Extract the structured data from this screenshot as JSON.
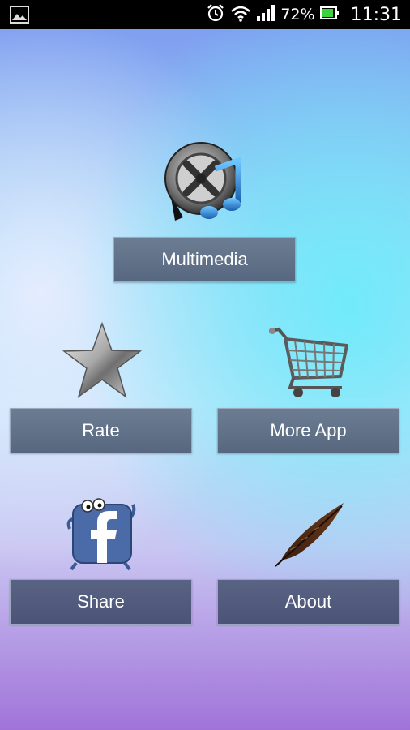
{
  "status_bar": {
    "battery": "72%",
    "time": "11:31",
    "icons": [
      "gallery-icon",
      "alarm-icon",
      "wifi-icon",
      "signal-icon",
      "battery-icon"
    ]
  },
  "menu": {
    "multimedia": "Multimedia",
    "rate": "Rate",
    "more_app": "More App",
    "share": "Share",
    "about": "About"
  },
  "icons": {
    "multimedia": "film-reel-music-icon",
    "rate": "star-icon",
    "more_app": "shopping-cart-icon",
    "share": "facebook-mascot-icon",
    "about": "feather-icon"
  }
}
